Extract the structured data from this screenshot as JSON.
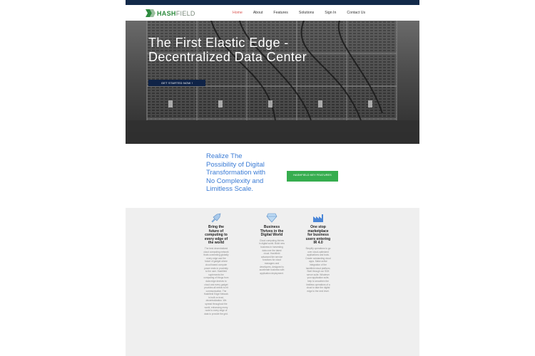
{
  "brand": {
    "name_part1": "HASH",
    "name_part2": "FIELD",
    "logo_icon": "hashfield-logo-mark",
    "green": "#2e8b3f",
    "navy": "#122a4a"
  },
  "nav": {
    "items": [
      "Home",
      "About",
      "Features",
      "Solutions",
      "Sign In",
      "Contact Us"
    ],
    "active": "Home"
  },
  "hero": {
    "title": "The First Elastic Edge - Decentralized Data Center",
    "cta": "GET STARTED NOW !"
  },
  "intro": {
    "heading": "Realize The Possibility of Digital Transformation with No Complexity and Limitless Scale.",
    "cta": "HASHFIELD KEY FEATURES"
  },
  "features": [
    {
      "icon": "rocket-icon",
      "title": "Bring the future of computing to every edge of the world",
      "body": "The best decentralized cloud computing network thats connecting globally every edge and the future of gadget where cloud based compute power ends in proximity to the user. Hashfield suplements the computing of things from data edge devices to cloud and every gadget provides all needs to hit communication. The Hashfield Edge Network is built on trust, decentralization. We spread throughout the world, enhancing every node to every edge of data to provide the grid."
    },
    {
      "icon": "diamond-icon",
      "title": "Business Thrives in the Digital World",
      "body": "Cloud computing thrives in digital world. Build new business in harvesting data over the latest cloud. Hashfield advanced tier service functions for cloud managers and developers, designed to accelerate business with application deployment."
    },
    {
      "icon": "factory-icon",
      "title": "One stop marketplace for business users entering IR 4.0",
      "body": "Simplify operations to go over cloud-optimized applications and tools. Create outstanding cloud apps. Make active integration of the hashfield cloud platform. Start through our SDK server suite. Whatever your application suite, help to smoothen the limitless operations of a cloud to take the digital edge to the next level."
    }
  ]
}
